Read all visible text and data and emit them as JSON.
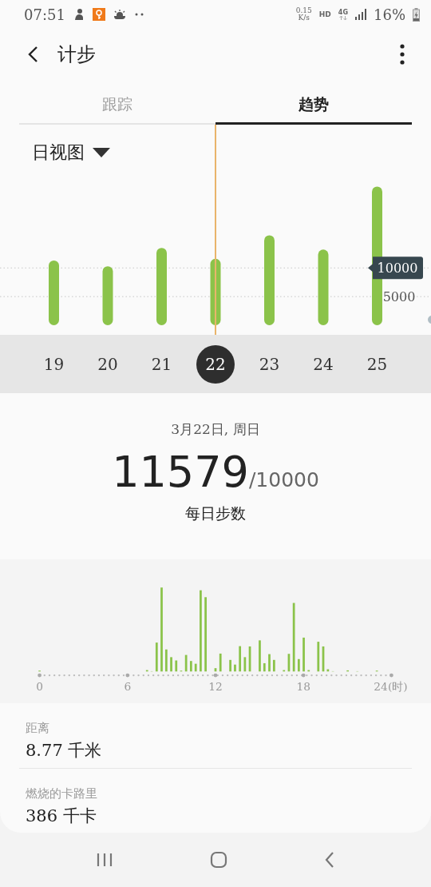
{
  "status_bar": {
    "time": "07:51",
    "net_speed": "0.15",
    "net_unit": "K/s",
    "hd": "HD",
    "network": "4G",
    "battery": "16%"
  },
  "header": {
    "title": "计步"
  },
  "tabs": [
    {
      "label": "跟踪",
      "selected": false
    },
    {
      "label": "趋势",
      "selected": true
    }
  ],
  "view_selector": {
    "label": "日视图"
  },
  "daily_chart": {
    "chart_data": {
      "type": "bar",
      "categories": [
        "19",
        "20",
        "21",
        "22",
        "23",
        "24",
        "25"
      ],
      "values": [
        11300,
        10300,
        13500,
        11600,
        15700,
        13200,
        24200
      ],
      "ylim": [
        0,
        35000
      ],
      "yticks": [
        5000,
        10000
      ]
    },
    "dates": [
      {
        "selected": false
      },
      {
        "selected": false
      },
      {
        "selected": false
      },
      {
        "selected": true
      },
      {
        "selected": false
      },
      {
        "selected": false
      },
      {
        "selected": false
      }
    ]
  },
  "summary": {
    "date": "3月22日, 周日",
    "steps": "11579",
    "goal": "/10000",
    "caption": "每日步数"
  },
  "hourly_chart": {
    "axis_labels": [
      "0",
      "6",
      "12",
      "18",
      "24(时)"
    ]
  },
  "metrics": [
    {
      "label": "距离",
      "value": "8.77 千米"
    },
    {
      "label": "燃烧的卡路里",
      "value": "386 千卡"
    }
  ]
}
